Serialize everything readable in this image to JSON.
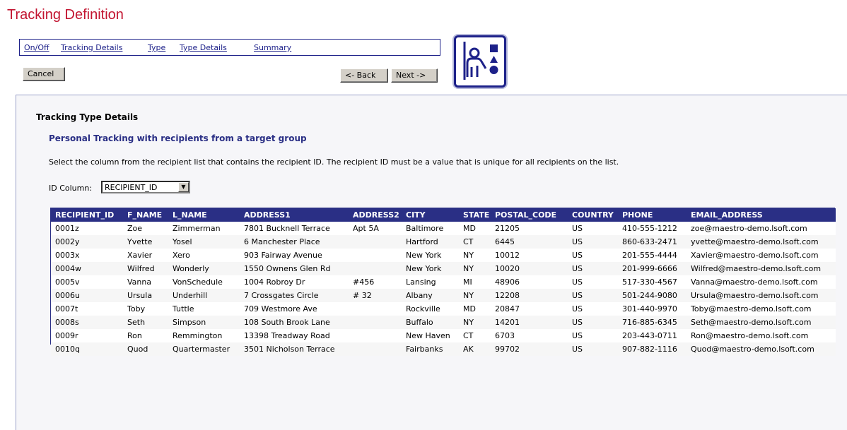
{
  "page": {
    "title": "Tracking Definition"
  },
  "nav": {
    "tabs": [
      {
        "label": "On/Off"
      },
      {
        "label": "Tracking Details"
      },
      {
        "label": "Type"
      },
      {
        "label": "Type Details"
      },
      {
        "label": "Summary"
      }
    ]
  },
  "buttons": {
    "cancel": "Cancel",
    "back": "<- Back",
    "next": "Next ->"
  },
  "icon": {
    "name": "wizard-presenter-icon",
    "accent": "#1d2189"
  },
  "panel": {
    "heading": "Tracking Type Details",
    "subheading": "Personal Tracking with recipients from a target group",
    "instructions": "Select the column from the recipient list that contains the recipient ID. The recipient ID must be a value that is unique for all recipients on the list.",
    "id_column_label": "ID Column:",
    "id_column_value": "RECIPIENT_ID"
  },
  "table": {
    "headers": [
      "RECIPIENT_ID",
      "F_NAME",
      "L_NAME",
      "ADDRESS1",
      "ADDRESS2",
      "CITY",
      "STATE",
      "POSTAL_CODE",
      "COUNTRY",
      "PHONE",
      "EMAIL_ADDRESS"
    ],
    "rows": [
      [
        "0001z",
        "Zoe",
        "Zimmerman",
        "7801 Bucknell Terrace",
        "Apt 5A",
        "Baltimore",
        "MD",
        "21205",
        "US",
        "410-555-1212",
        "zoe@maestro-demo.lsoft.com"
      ],
      [
        "0002y",
        "Yvette",
        "Yosel",
        "6 Manchester Place",
        "",
        "Hartford",
        "CT",
        "6445",
        "US",
        "860-633-2471",
        "yvette@maestro-demo.lsoft.com"
      ],
      [
        "0003x",
        "Xavier",
        "Xero",
        "903 Fairway Avenue",
        "",
        "New York",
        "NY",
        "10012",
        "US",
        "201-555-4444",
        "Xavier@maestro-demo.lsoft.com"
      ],
      [
        "0004w",
        "Wilfred",
        "Wonderly",
        "1550 Ownens Glen Rd",
        "",
        "New York",
        "NY",
        "10020",
        "US",
        "201-999-6666",
        "Wilfred@maestro-demo.lsoft.com"
      ],
      [
        "0005v",
        "Vanna",
        "VonSchedule",
        "1004 Robroy Dr",
        "#456",
        "Lansing",
        "MI",
        "48906",
        "US",
        "517-330-4567",
        "Vanna@maestro-demo.lsoft.com"
      ],
      [
        "0006u",
        "Ursula",
        "Underhill",
        "7 Crossgates Circle",
        "# 32",
        "Albany",
        "NY",
        "12208",
        "US",
        "501-244-9080",
        "Ursula@maestro-demo.lsoft.com"
      ],
      [
        "0007t",
        "Toby",
        "Tuttle",
        "709 Westmore Ave",
        "",
        "Rockville",
        "MD",
        "20847",
        "US",
        "301-440-9970",
        "Toby@maestro-demo.lsoft.com"
      ],
      [
        "0008s",
        "Seth",
        "Simpson",
        "108 South Brook Lane",
        "",
        "Buffalo",
        "NY",
        "14201",
        "US",
        "716-885-6345",
        "Seth@maestro-demo.lsoft.com"
      ],
      [
        "0009r",
        "Ron",
        "Remmington",
        "13398 Treadway Road",
        "",
        "New Haven",
        "CT",
        "6703",
        "US",
        "203-443-0711",
        "Ron@maestro-demo.lsoft.com"
      ],
      [
        "0010q",
        "Quod",
        "Quartermaster",
        "3501 Nicholson Terrace",
        "",
        "Fairbanks",
        "AK",
        "99702",
        "US",
        "907-882-1116",
        "Quod@maestro-demo.lsoft.com"
      ]
    ]
  }
}
